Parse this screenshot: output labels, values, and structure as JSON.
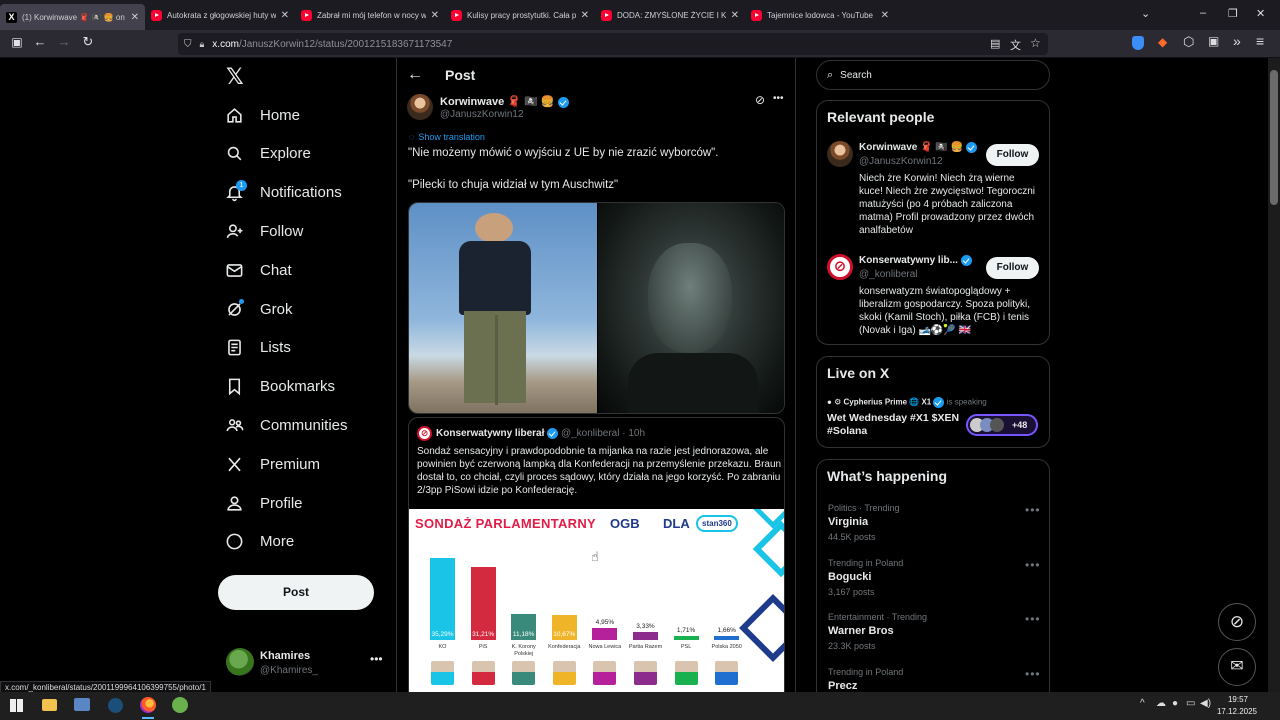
{
  "browser": {
    "tabs": [
      {
        "title": "(1) Korwinwave 🧣 🏴‍☠️ 🍔 on X: \"N",
        "favicon": "x",
        "active": true
      },
      {
        "title": "Autokrata z głogowskiej huty w",
        "favicon": "yt"
      },
      {
        "title": "Zabrał mi mój telefon w nocy w",
        "favicon": "yt"
      },
      {
        "title": "Kulisy pracy prostytutki. Cała p",
        "favicon": "yt"
      },
      {
        "title": "DODA: ZMYŚLONE ŻYCIE I KARI",
        "favicon": "yt"
      },
      {
        "title": "Tajemnice lodowca - YouTube",
        "favicon": "yt"
      }
    ],
    "url_domain": "x.com",
    "url_path": "/JanuszKorwin12/status/2001215183671173547",
    "status_url": "x.com/_konliberal/status/2001199964106399755/photo/1",
    "window_buttons": [
      "–",
      "❐",
      "✕"
    ]
  },
  "sidebar": {
    "logo": "𝕏",
    "items": [
      {
        "label": "Home",
        "icon": "home-icon"
      },
      {
        "label": "Explore",
        "icon": "search-icon"
      },
      {
        "label": "Notifications",
        "icon": "bell-icon",
        "badge": "1"
      },
      {
        "label": "Follow",
        "icon": "person-add-icon"
      },
      {
        "label": "Chat",
        "icon": "mail-icon"
      },
      {
        "label": "Grok",
        "icon": "grok-icon"
      },
      {
        "label": "Lists",
        "icon": "list-icon"
      },
      {
        "label": "Bookmarks",
        "icon": "bookmark-icon"
      },
      {
        "label": "Communities",
        "icon": "communities-icon"
      },
      {
        "label": "Premium",
        "icon": "x-premium-icon"
      },
      {
        "label": "Profile",
        "icon": "profile-icon"
      },
      {
        "label": "More",
        "icon": "more-circle-icon"
      }
    ],
    "post_button": "Post",
    "account": {
      "name": "Khamires",
      "handle": "@Khamires_"
    }
  },
  "post": {
    "header_title": "Post",
    "author_name": "Korwinwave 🧣 🏴‍☠️ 🍔",
    "author_handle": "@JanuszKorwin12",
    "show_translation": "Show translation",
    "text_line1": "\"Nie możemy mówić o wyjściu z UE by nie zrazić wyborców\".",
    "text_line2": "\"Pilecki to chuja widział w tym Auschwitz\"",
    "quote": {
      "author_name": "Konserwatywny liberał",
      "author_handle": "@_konliberal",
      "time": "· 10h",
      "text": "Sondaż sensacyjny i prawdopodobnie ta mijanka na razie jest jednorazowa, ale powinien być czerwoną lampką dla Konfederacji na przemyślenie przekazu. Braun dostał to, co chciał, czyli proces sądowy, który działa na jego korzyść. Po zabraniu 2/3pp PiSowi idzie po Konfederację."
    }
  },
  "chart_data": {
    "type": "bar",
    "title": "SONDAŻ PARLAMENTARNY",
    "brand": "OGB",
    "dla": "DLA",
    "partner": "stan360",
    "categories": [
      "KO",
      "PiS",
      "K. Korony Polskiej",
      "Konfederacja",
      "Nowa Lewica",
      "Partia Razem",
      "PSL",
      "Polska 2050"
    ],
    "values": [
      35.29,
      31.21,
      11.18,
      10.67,
      4.95,
      3.33,
      1.71,
      1.66
    ],
    "value_labels": [
      "35,29%",
      "31,21%",
      "11,18%",
      "10,67%",
      "4,95%",
      "3,33%",
      "1,71%",
      "1,66%"
    ],
    "colors": [
      "#19c4e6",
      "#d42a3f",
      "#3a8a7c",
      "#f0b429",
      "#b5219a",
      "#8c2c8c",
      "#19b050",
      "#1f6fd1"
    ]
  },
  "right": {
    "search_placeholder": "Search",
    "relevant": {
      "title": "Relevant people",
      "people": [
        {
          "name": "Korwinwave 🧣 🏴‍☠️ 🍔",
          "handle": "@JanuszKorwin12",
          "follow": "Follow",
          "bio": "Niech żre Korwin! Niech żrą wierne kuce! Niech żre zwycięstwo! Tegoroczni matużyści (po 4 próbach zaliczona matma) Profil prowadzony przez dwóch analfabetów"
        },
        {
          "name": "Konserwatywny lib...",
          "handle": "@_konliberal",
          "follow": "Follow",
          "bio": "konserwatyzm światopoglądowy + liberalizm gospodarczy. Spoza polityki, skoki (Kamil Stoch), piłka (FCB) i tenis (Novak i Iga) 🎿⚽🎾 🇬🇧"
        }
      ]
    },
    "live": {
      "title": "Live on X",
      "host": "⚙ Cypherius Prime 🌐 X1",
      "speaking": "is speaking",
      "space_title": "Wet Wednesday #X1 $XEN #Solana",
      "extra": "+48"
    },
    "happening": {
      "title": "What’s happening",
      "trends": [
        {
          "category": "Politics · Trending",
          "topic": "Virginia",
          "posts": "44.5K posts"
        },
        {
          "category": "Trending in Poland",
          "topic": "Bogucki",
          "posts": "3,167 posts"
        },
        {
          "category": "Entertainment · Trending",
          "topic": "Warner Bros",
          "posts": "23.3K posts"
        },
        {
          "category": "Trending in Poland",
          "topic": "Precz",
          "posts": ""
        }
      ]
    }
  },
  "taskbar": {
    "time": "19:57",
    "date": "17.12.2025"
  }
}
